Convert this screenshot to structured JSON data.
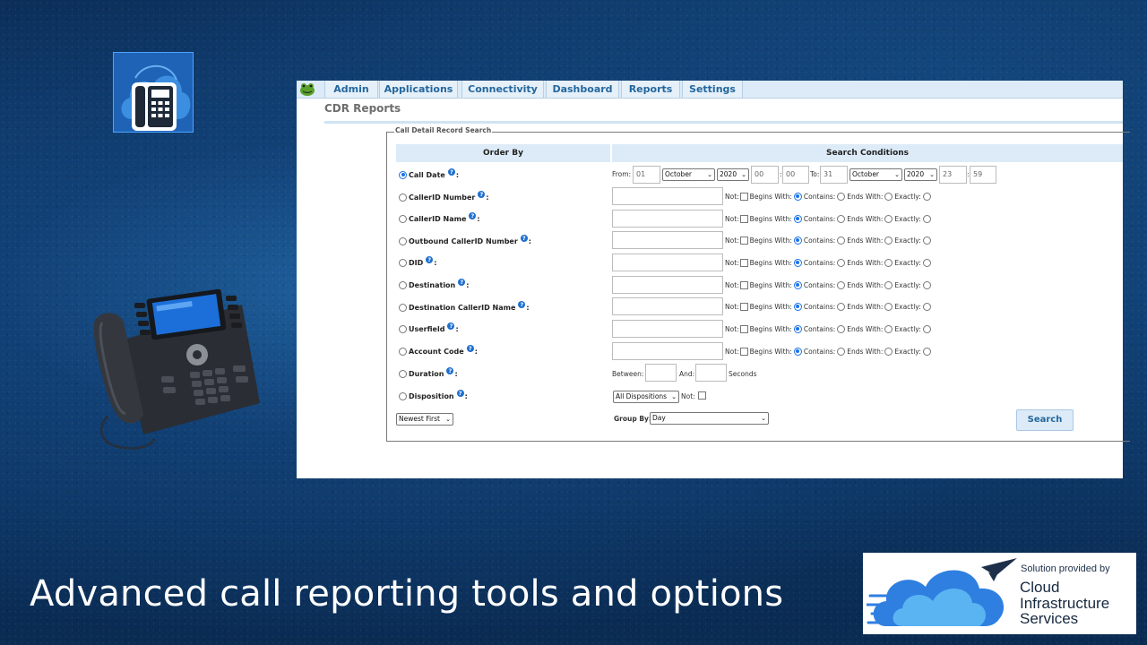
{
  "app": {
    "menu": [
      "Admin",
      "Applications",
      "Connectivity",
      "Dashboard",
      "Reports",
      "Settings"
    ],
    "page_title": "CDR Reports",
    "legend": "Call Detail Record Search",
    "columns": {
      "order_by": "Order By",
      "search_conditions": "Search Conditions"
    },
    "call_date": {
      "label": "Call Date",
      "from_label": "From:",
      "from_day": "01",
      "from_month": "October",
      "from_year": "2020",
      "from_hour": "00",
      "from_minute": "00",
      "to_label": "To:",
      "to_day": "31",
      "to_month": "October",
      "to_year": "2020",
      "to_hour": "23",
      "to_minute": "59"
    },
    "text_fields": [
      "CallerID Number",
      "CallerID Name",
      "Outbound CallerID Number",
      "DID",
      "Destination",
      "Destination CallerID Name",
      "Userfield",
      "Account Code"
    ],
    "match_options": {
      "not": "Not:",
      "begins": "Begins With:",
      "contains": "Contains:",
      "ends": "Ends With:",
      "exactly": "Exactly:"
    },
    "duration": {
      "label": "Duration",
      "between": "Between:",
      "and": "And:",
      "seconds": "Seconds"
    },
    "disposition": {
      "label": "Disposition",
      "selected": "All Dispositions",
      "not": "Not:"
    },
    "sort": {
      "selected": "Newest First"
    },
    "group_by": {
      "label": "Group By:",
      "selected": "Day"
    },
    "search_button": "Search"
  },
  "caption": "Advanced call reporting tools and options",
  "badge": {
    "provided_by": "Solution provided by",
    "name_line1": "Cloud",
    "name_line2": "Infrastructure",
    "name_line3": "Services"
  },
  "colors": {
    "menu_text": "#23679d",
    "header_bg": "#dcebf7",
    "radio_selected": "#1a73e8",
    "help_icon": "#1e6fcf"
  },
  "icons": [
    "cloud-phone-icon",
    "desk-phone-image",
    "frog-logo-icon",
    "help-icon",
    "cloud-logo-icon"
  ]
}
